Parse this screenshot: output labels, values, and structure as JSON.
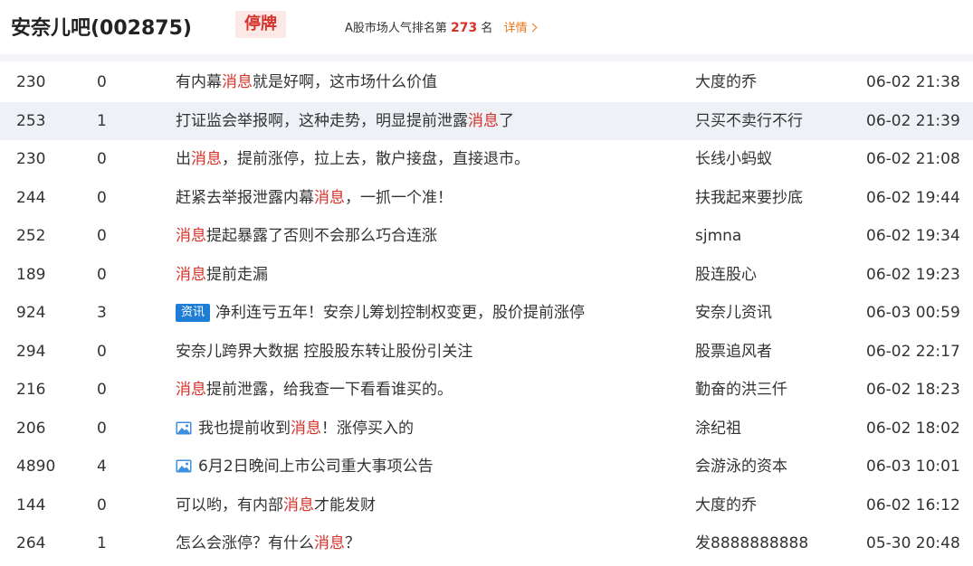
{
  "header": {
    "bar_title": "安奈儿吧(002875)",
    "status_badge": "停牌",
    "rank_prefix": "A股市场人气排名第",
    "rank_value": "273",
    "rank_suffix": "名",
    "detail_link": "详情"
  },
  "colors": {
    "keyword": "#d6312a",
    "info_tag": "#1e7ed6",
    "link": "#e8761a",
    "alt_row": "#eef2f7"
  },
  "posts": [
    {
      "reads": "230",
      "replies": "0",
      "tag": "",
      "has_image": false,
      "title_parts": [
        {
          "t": "有内幕"
        },
        {
          "t": "消息",
          "kw": true
        },
        {
          "t": "就是好啊，这市场什么价值"
        }
      ],
      "author": "大度的乔",
      "time": "06-02 21:38"
    },
    {
      "reads": "253",
      "replies": "1",
      "tag": "",
      "has_image": false,
      "title_parts": [
        {
          "t": "打证监会举报啊，这种走势，明显提前泄露"
        },
        {
          "t": "消息",
          "kw": true
        },
        {
          "t": "了"
        }
      ],
      "author": "只买不卖行不行",
      "time": "06-02 21:39"
    },
    {
      "reads": "230",
      "replies": "0",
      "tag": "",
      "has_image": false,
      "title_parts": [
        {
          "t": "出"
        },
        {
          "t": "消息",
          "kw": true
        },
        {
          "t": "，提前涨停，拉上去，散户接盘，直接退市。"
        }
      ],
      "author": "长线小蚂蚁",
      "time": "06-02 21:08"
    },
    {
      "reads": "244",
      "replies": "0",
      "tag": "",
      "has_image": false,
      "title_parts": [
        {
          "t": "赶紧去举报泄露内幕"
        },
        {
          "t": "消息",
          "kw": true
        },
        {
          "t": "，一抓一个准！"
        }
      ],
      "author": "扶我起来要抄底",
      "time": "06-02 19:44"
    },
    {
      "reads": "252",
      "replies": "0",
      "tag": "",
      "has_image": false,
      "title_parts": [
        {
          "t": "消息",
          "kw": true
        },
        {
          "t": "提起暴露了否则不会那么巧合连涨"
        }
      ],
      "author": "sjmna",
      "time": "06-02 19:34"
    },
    {
      "reads": "189",
      "replies": "0",
      "tag": "",
      "has_image": false,
      "title_parts": [
        {
          "t": "消息",
          "kw": true
        },
        {
          "t": "提前走漏"
        }
      ],
      "author": "股连股心",
      "time": "06-02 19:23"
    },
    {
      "reads": "924",
      "replies": "3",
      "tag": "资讯",
      "has_image": false,
      "title_parts": [
        {
          "t": "净利连亏五年！安奈儿筹划控制权变更，股价提前涨停"
        }
      ],
      "author": "安奈儿资讯",
      "time": "06-03 00:59"
    },
    {
      "reads": "294",
      "replies": "0",
      "tag": "",
      "has_image": false,
      "title_parts": [
        {
          "t": "安奈儿跨界大数据 控股股东转让股份引关注"
        }
      ],
      "author": "股票追风者",
      "time": "06-02 22:17"
    },
    {
      "reads": "216",
      "replies": "0",
      "tag": "",
      "has_image": false,
      "title_parts": [
        {
          "t": "消息",
          "kw": true
        },
        {
          "t": "提前泄露，给我查一下看看谁买的。"
        }
      ],
      "author": "勤奋的洪三仟",
      "time": "06-02 18:23"
    },
    {
      "reads": "206",
      "replies": "0",
      "tag": "",
      "has_image": true,
      "title_parts": [
        {
          "t": "我也提前收到"
        },
        {
          "t": "消息",
          "kw": true
        },
        {
          "t": "！涨停买入的"
        }
      ],
      "author": "涂纪祖",
      "time": "06-02 18:02"
    },
    {
      "reads": "4890",
      "replies": "4",
      "tag": "",
      "has_image": true,
      "title_parts": [
        {
          "t": "6月2日晚间上市公司重大事项公告"
        }
      ],
      "author": "会游泳的资本",
      "time": "06-03 10:01"
    },
    {
      "reads": "144",
      "replies": "0",
      "tag": "",
      "has_image": false,
      "title_parts": [
        {
          "t": "可以哟，有内部"
        },
        {
          "t": "消息",
          "kw": true
        },
        {
          "t": "才能发财"
        }
      ],
      "author": "大度的乔",
      "time": "06-02 16:12"
    },
    {
      "reads": "264",
      "replies": "1",
      "tag": "",
      "has_image": false,
      "title_parts": [
        {
          "t": "怎么会涨停？有什么"
        },
        {
          "t": "消息",
          "kw": true
        },
        {
          "t": "？"
        }
      ],
      "author": "发8888888888",
      "time": "05-30 20:48"
    }
  ]
}
